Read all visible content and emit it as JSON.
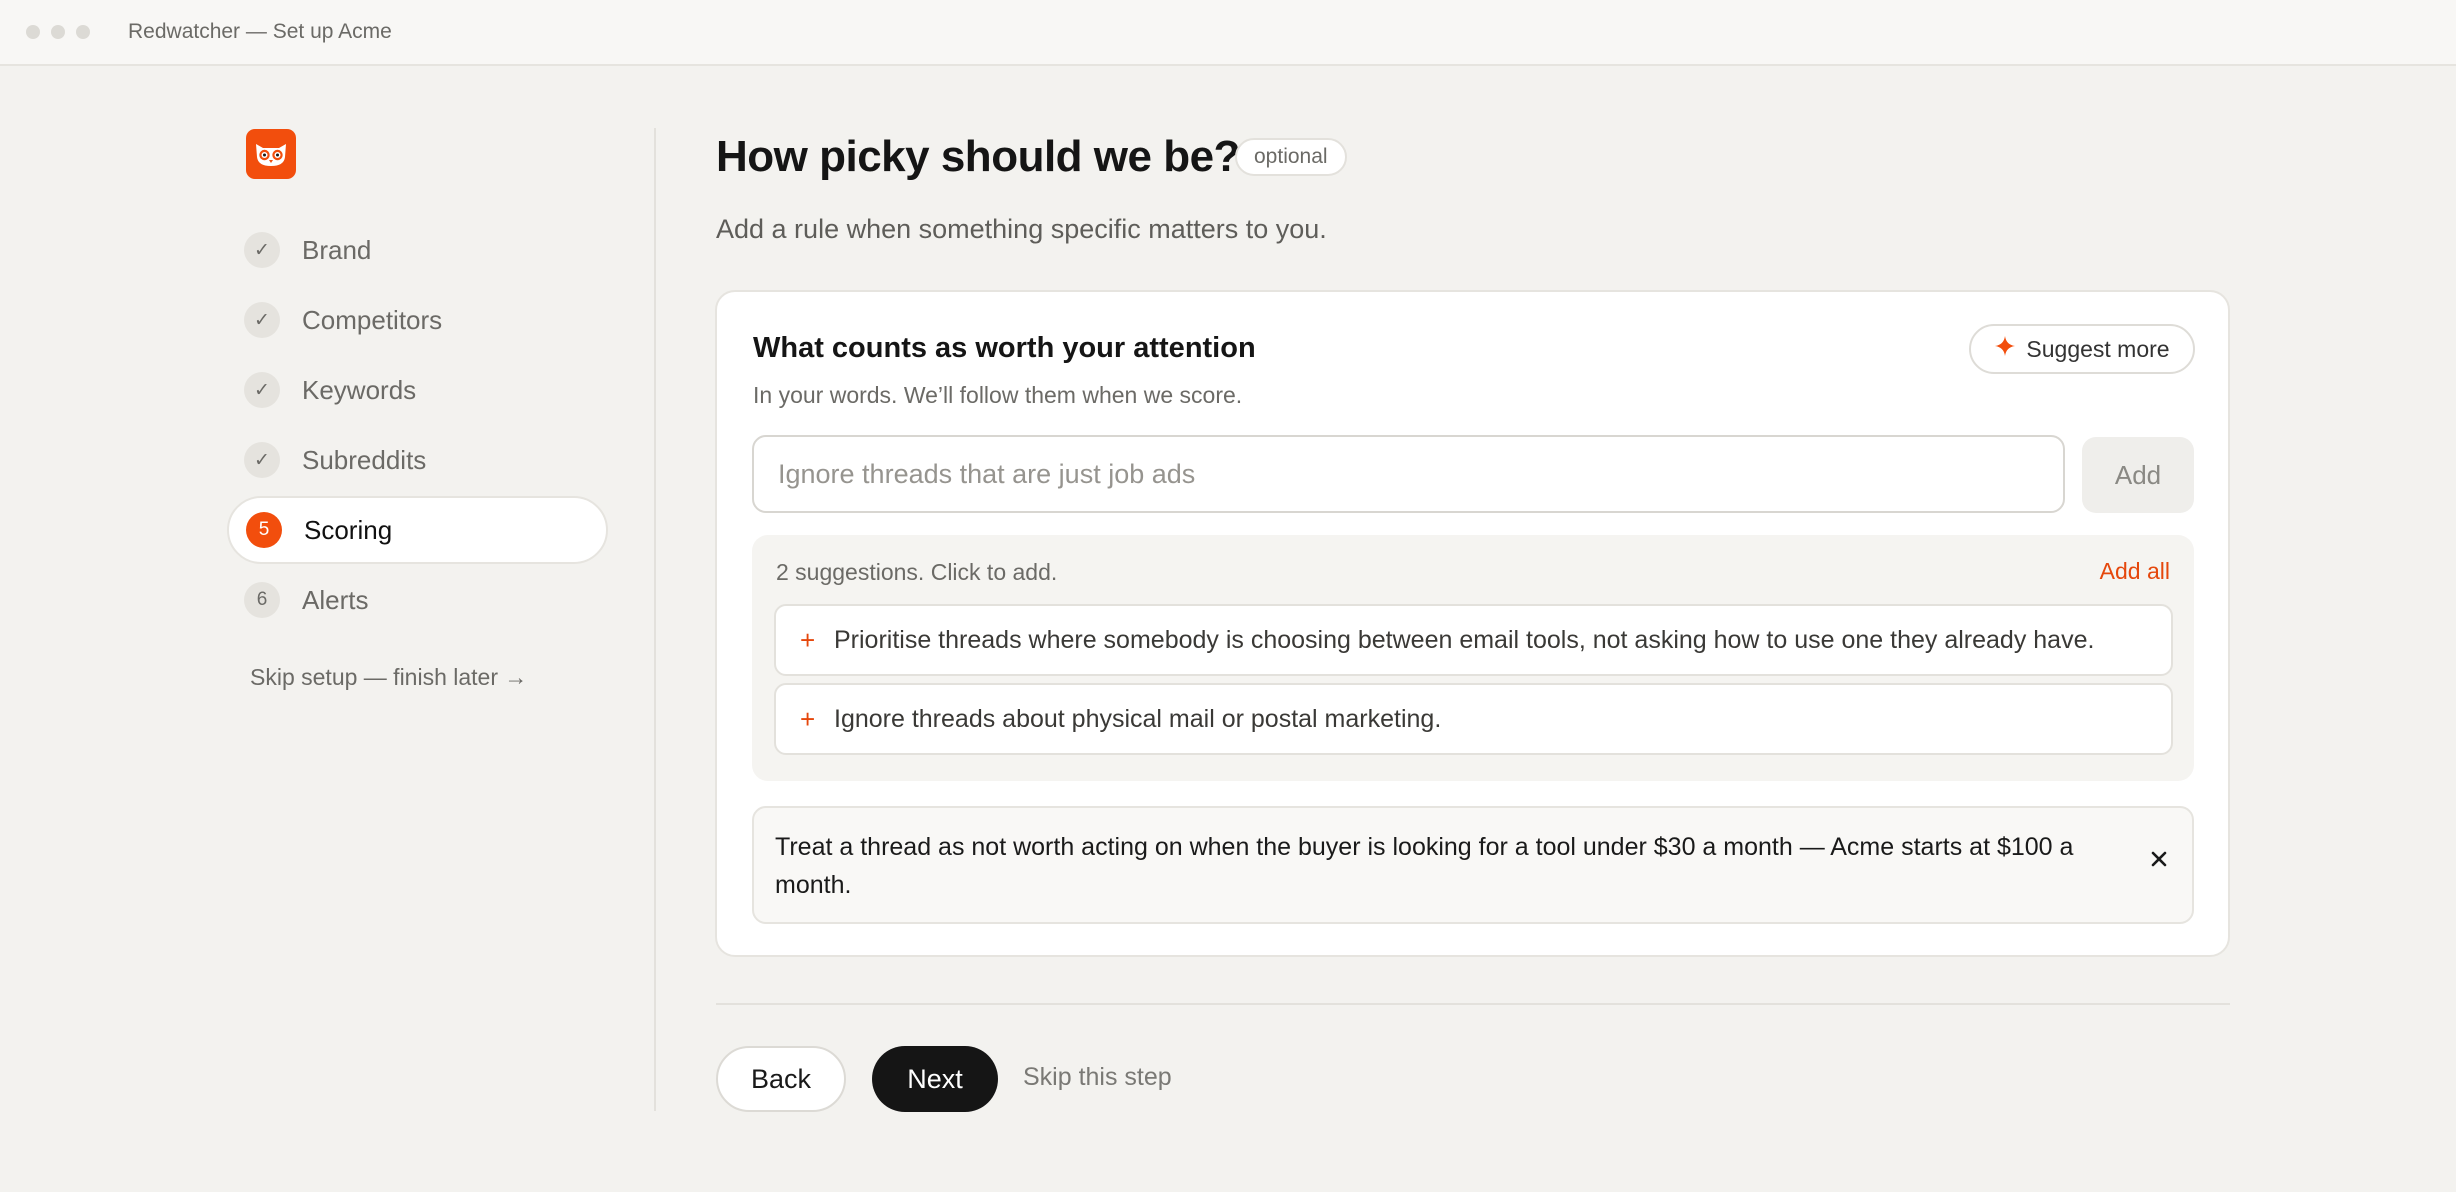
{
  "window": {
    "title": "Redwatcher — Set up Acme"
  },
  "sidebar": {
    "logo_icon": "owl-logo",
    "steps": [
      {
        "badge": "✓",
        "label": "Brand",
        "state": "done"
      },
      {
        "badge": "✓",
        "label": "Competitors",
        "state": "done"
      },
      {
        "badge": "✓",
        "label": "Keywords",
        "state": "done"
      },
      {
        "badge": "✓",
        "label": "Subreddits",
        "state": "done"
      },
      {
        "badge": "5",
        "label": "Scoring",
        "state": "active"
      },
      {
        "badge": "6",
        "label": "Alerts",
        "state": "pending"
      }
    ],
    "skip_setup": "Skip setup — finish later →"
  },
  "main": {
    "title": "How picky should we be?",
    "optional_badge": "optional",
    "subtitle": "Add a rule when something specific matters to you."
  },
  "card": {
    "title": "What counts as worth your attention",
    "description": "In your words. We’ll follow them when we score.",
    "suggest_more": "Suggest more",
    "input_placeholder": "Ignore threads that are just job ads",
    "input_value": "",
    "add_button": "Add",
    "suggestions_header": "2 suggestions. Click to add.",
    "add_all": "Add all",
    "suggestions": [
      "Prioritise threads where somebody is choosing between email tools, not asking how to use one they already have.",
      "Ignore threads about physical mail or postal marketing."
    ],
    "rules": [
      "Treat a thread as not worth acting on when the buyer is looking for a tool under $30 a month — Acme starts at $100 a month."
    ]
  },
  "footer": {
    "back": "Back",
    "next": "Next",
    "skip_step": "Skip this step"
  },
  "colors": {
    "accent": "#f24e0d",
    "background": "#f3f2ef",
    "primary_button": "#151515"
  }
}
